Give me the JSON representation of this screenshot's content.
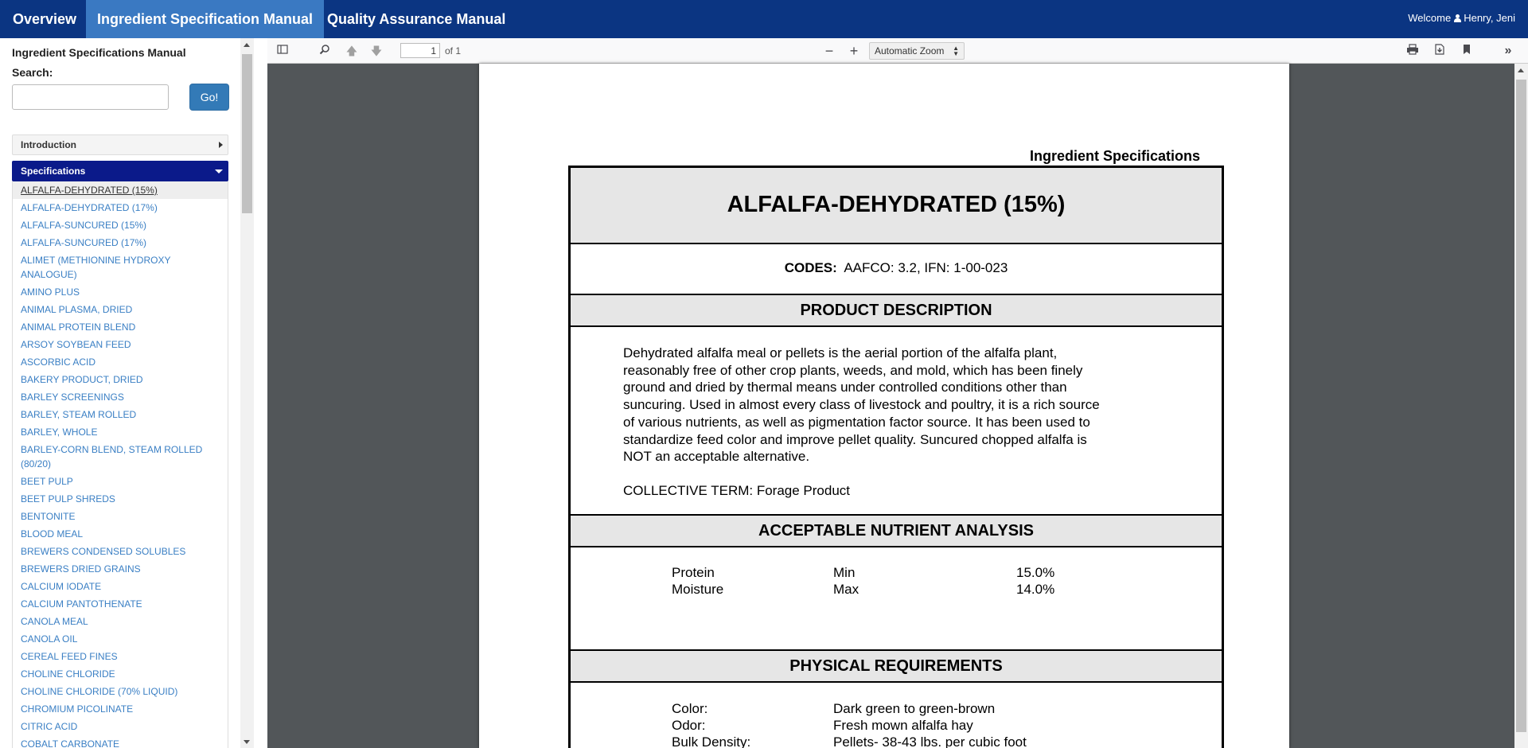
{
  "nav": {
    "tabs": [
      {
        "label": "Overview"
      },
      {
        "label": "Ingredient Specification Manual"
      },
      {
        "label": "Quality Assurance Manual"
      }
    ],
    "welcome_prefix": "Welcome",
    "user_name": "Henry, Jeni"
  },
  "sidebar": {
    "title": "Ingredient Specifications Manual",
    "search_label": "Search:",
    "search_value": "",
    "go_label": "Go!",
    "intro_label": "Introduction",
    "spec_label": "Specifications",
    "items": [
      "ALFALFA-DEHYDRATED (15%)",
      "ALFALFA-DEHYDRATED (17%)",
      "ALFALFA-SUNCURED (15%)",
      "ALFALFA-SUNCURED (17%)",
      "ALIMET (METHIONINE HYDROXY ANALOGUE)",
      "AMINO PLUS",
      "ANIMAL PLASMA, DRIED",
      "ANIMAL PROTEIN BLEND",
      "ARSOY SOYBEAN FEED",
      "ASCORBIC ACID",
      "BAKERY PRODUCT, DRIED",
      "BARLEY SCREENINGS",
      "BARLEY, STEAM ROLLED",
      "BARLEY, WHOLE",
      "BARLEY-CORN BLEND, STEAM ROLLED (80/20)",
      "BEET PULP",
      "BEET PULP SHREDS",
      "BENTONITE",
      "BLOOD MEAL",
      "BREWERS CONDENSED SOLUBLES",
      "BREWERS DRIED GRAINS",
      "CALCIUM IODATE",
      "CALCIUM PANTOTHENATE",
      "CANOLA MEAL",
      "CANOLA OIL",
      "CEREAL FEED FINES",
      "CHOLINE CHLORIDE",
      "CHOLINE CHLORIDE (70% LIQUID)",
      "CHROMIUM PICOLINATE",
      "CITRIC ACID",
      "COBALT CARBONATE"
    ],
    "selected_index": 0
  },
  "viewer": {
    "page_number": "1",
    "page_count_text": "of 1",
    "zoom": "Automatic Zoom",
    "icons": [
      "sidebar-toggle-icon",
      "search-icon",
      "previous-page-icon",
      "next-page-icon",
      "zoom-out-icon",
      "zoom-in-icon",
      "print-icon",
      "download-icon",
      "bookmark-icon",
      "tools-icon"
    ]
  },
  "document": {
    "header": "Ingredient Specifications",
    "title": "ALFALFA-DEHYDRATED (15%)",
    "codes_label": "CODES:",
    "codes_value": "AAFCO: 3.2, IFN: 1-00-023",
    "product_description_heading": "PRODUCT DESCRIPTION",
    "description_lines": [
      "Dehydrated alfalfa meal or pellets is the aerial portion of the alfalfa plant,",
      "reasonably free of other crop plants, weeds, and mold, which has been finely",
      "ground and dried by thermal means under controlled conditions other than",
      "suncuring.  Used in almost every class of livestock and poultry, it is a rich source",
      "of various nutrients, as well as pigmentation factor source.  It has been used to",
      "standardize feed color and improve pellet quality.  Suncured chopped alfalfa is",
      "NOT an acceptable alternative."
    ],
    "collective_term": "COLLECTIVE TERM:  Forage Product",
    "nutrient_heading": "ACCEPTABLE NUTRIENT ANALYSIS",
    "nutrients": [
      {
        "name": "Protein",
        "limit": "Min",
        "value": "15.0%"
      },
      {
        "name": "Moisture",
        "limit": "Max",
        "value": "14.0%"
      }
    ],
    "physical_heading": "PHYSICAL REQUIREMENTS",
    "physical": [
      {
        "name": "Color:",
        "value": "Dark green to green-brown"
      },
      {
        "name": "Odor:",
        "value": "Fresh mown alfalfa hay"
      },
      {
        "name": "Bulk Density:",
        "value": "Pellets- 38-43 lbs. per cubic foot"
      }
    ]
  }
}
